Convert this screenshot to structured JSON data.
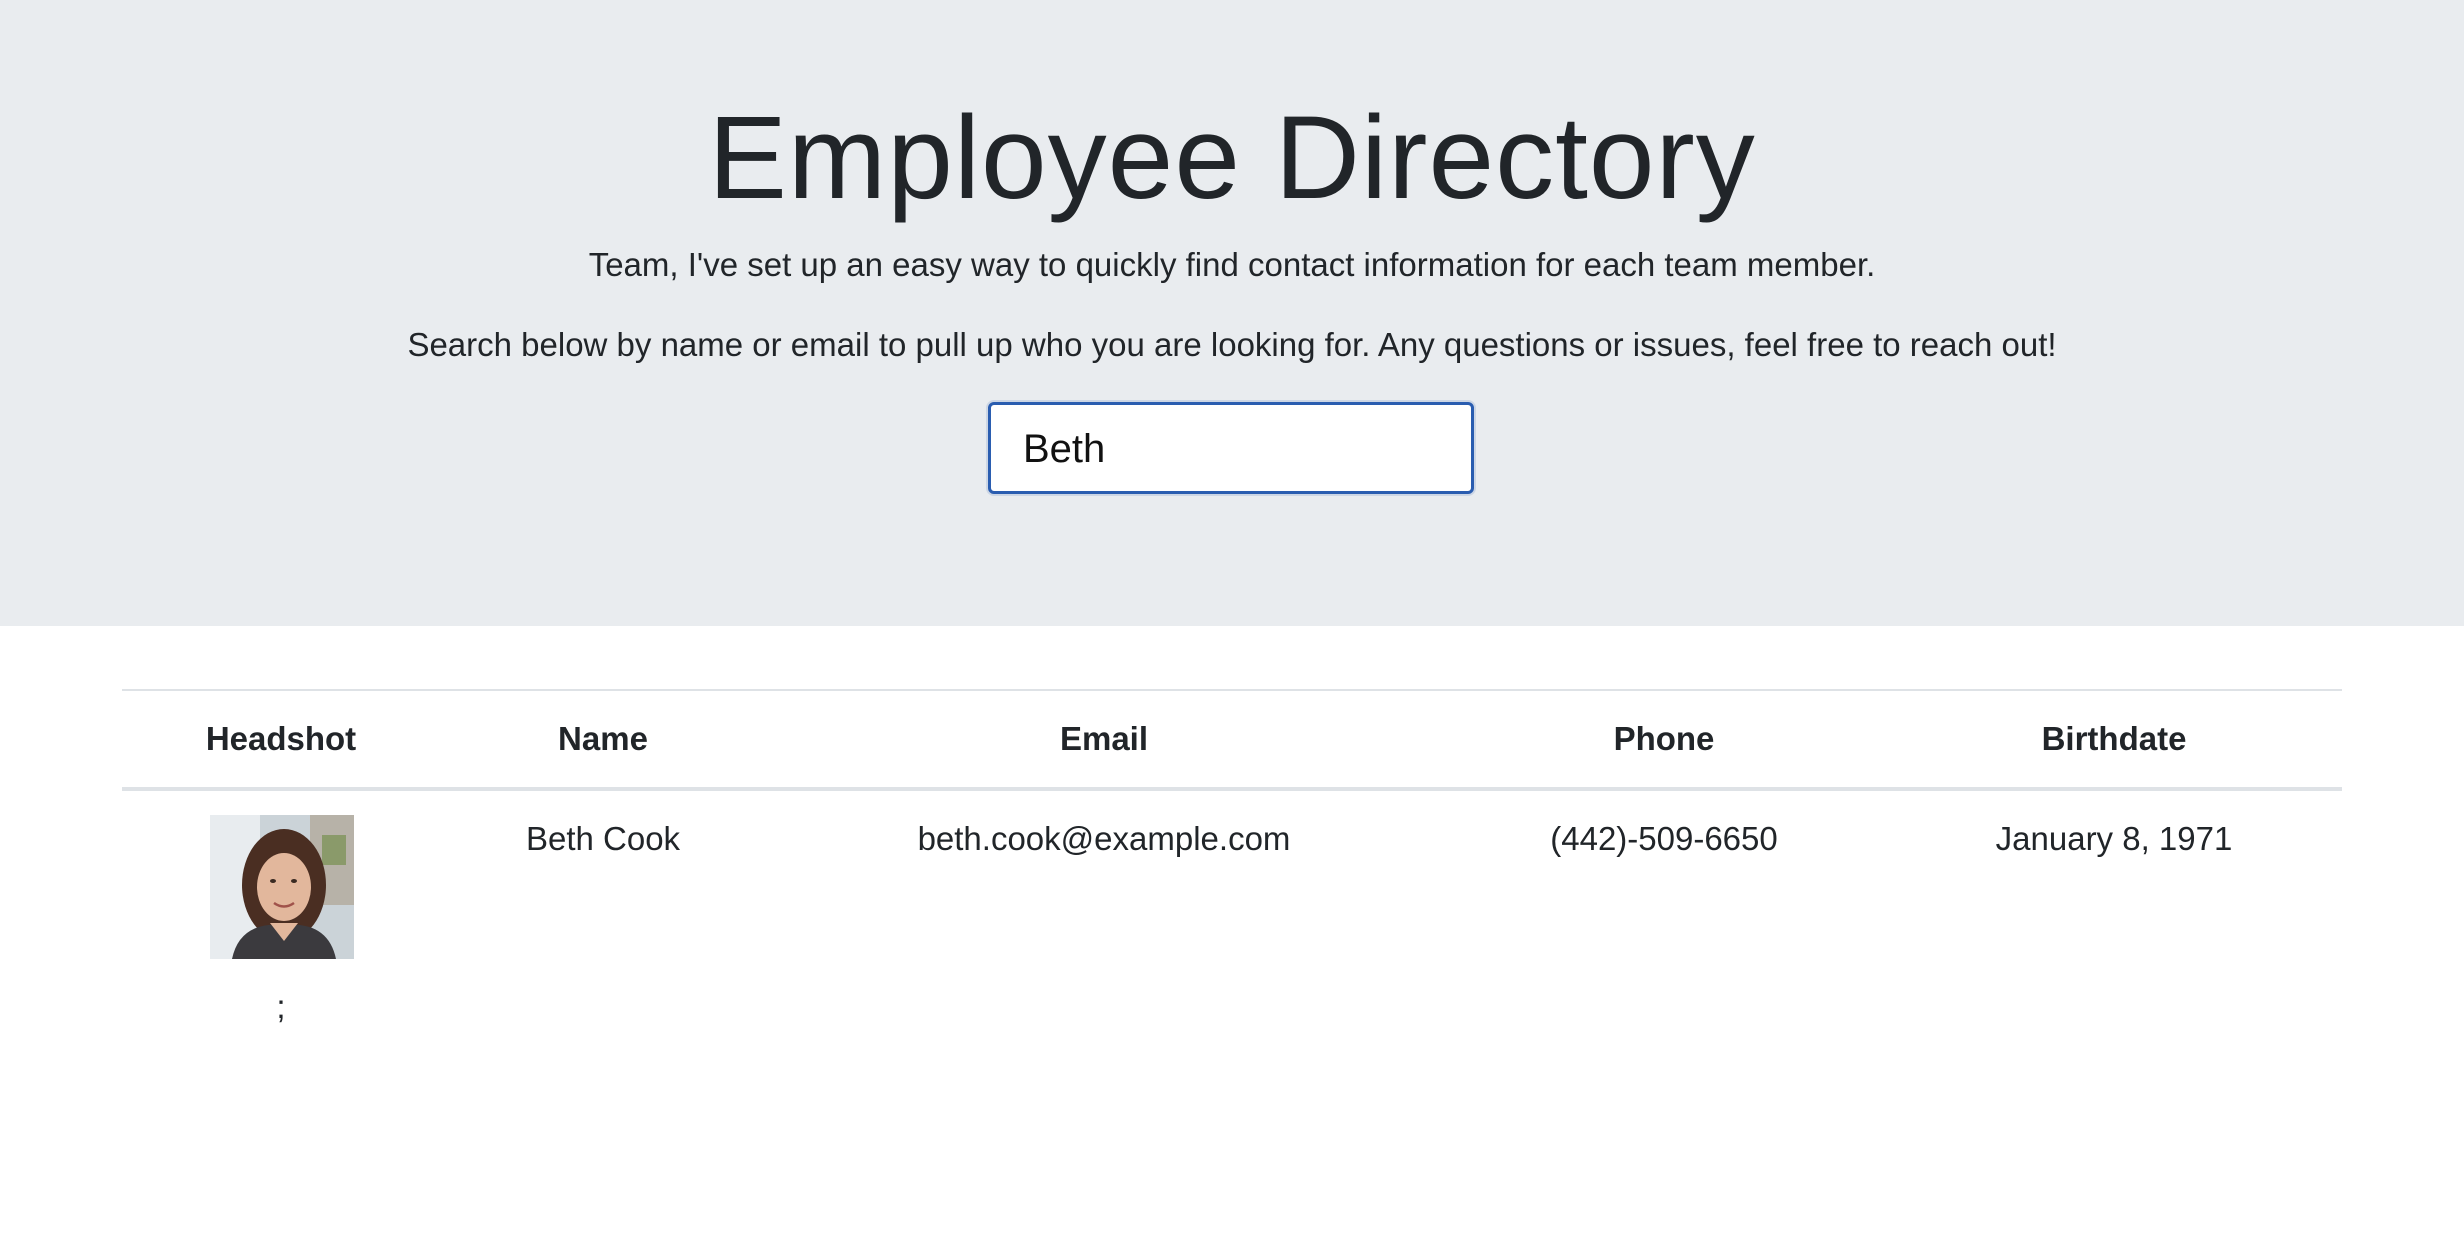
{
  "header": {
    "title": "Employee Directory",
    "intro_line_1": "Team, I've set up an easy way to quickly find contact information for each team member.",
    "intro_line_2": "Search below by name or email to pull up who you are looking for. Any questions or issues, feel free to reach out!"
  },
  "search": {
    "value": "Beth",
    "focus_color": "#2a5db0"
  },
  "table": {
    "columns": [
      "Headshot",
      "Name",
      "Email",
      "Phone",
      "Birthdate"
    ],
    "rows": [
      {
        "headshot": "headshot-photo",
        "name": "Beth Cook",
        "email": "beth.cook@example.com",
        "phone": "(442)-509-6650",
        "birthdate": "January 8, 1971",
        "trailing_text": ";"
      }
    ]
  },
  "colors": {
    "jumbotron_bg": "#e9ecef",
    "text": "#212529",
    "rule": "#dee2e6"
  }
}
